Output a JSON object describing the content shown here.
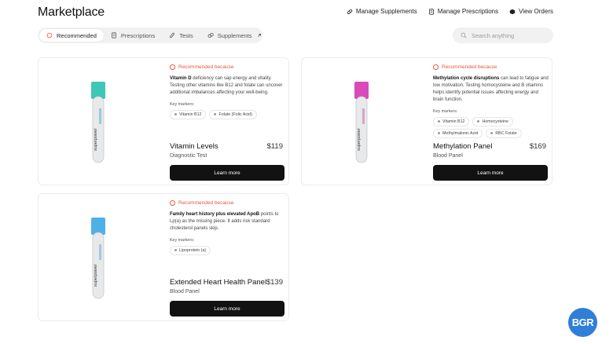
{
  "header": {
    "title": "Marketplace"
  },
  "topnav": [
    {
      "label": "Manage Supplements",
      "icon": "pill-icon"
    },
    {
      "label": "Manage Prescriptions",
      "icon": "document-icon"
    },
    {
      "label": "View Orders",
      "icon": "box-icon"
    }
  ],
  "tabs": [
    {
      "label": "Recommended",
      "active": true
    },
    {
      "label": "Prescriptions"
    },
    {
      "label": "Tests"
    },
    {
      "label": "Supplements",
      "external": true
    }
  ],
  "search": {
    "placeholder": "Search anything"
  },
  "cards": [
    {
      "rec_label": "Recommended because",
      "desc_bold": "Vitamin D",
      "desc_rest": " deficiency can sap energy and vitality. Testing other vitamins like B12 and folate can uncover additional imbalances affecting your well-being.",
      "km_label": "Key markers:",
      "markers": [
        "Vitamin B12",
        "Folate (Folic Acid)"
      ],
      "name": "Vitamin Levels",
      "type": "Diagnostic Test",
      "price": "$119",
      "button": "Learn more",
      "cap_color": "#3dc7b6"
    },
    {
      "rec_label": "Recommended because",
      "desc_bold": "Methylation cycle disruptions",
      "desc_rest": " can lead to fatigue and low motivation. Testing homocysteine and B vitamins helps identify potential issues affecting energy and brain function.",
      "km_label": "Key markers:",
      "markers": [
        "Vitamin B12",
        "Homocysteine",
        "Methylmalonic Acid",
        "RBC Folate"
      ],
      "name": "Methylation Panel",
      "type": "Blood Panel",
      "price": "$169",
      "button": "Learn more",
      "cap_color": "#d94bb8"
    },
    {
      "rec_label": "Recommended because",
      "desc_bold": "Family heart history plus elevated ApoB",
      "desc_rest": " points to Lp(a) as the missing piece. It adds risk standard cholesterol panels skip.",
      "km_label": "Key markers:",
      "markers": [
        "Lipoprotein (a)"
      ],
      "name": "Extended Heart Health Panel",
      "type": "Blood Panel",
      "price": "$139",
      "button": "Learn more",
      "cap_color": "#4fb0e8"
    }
  ],
  "tube_brand": "superpower",
  "watermark": "BGR"
}
